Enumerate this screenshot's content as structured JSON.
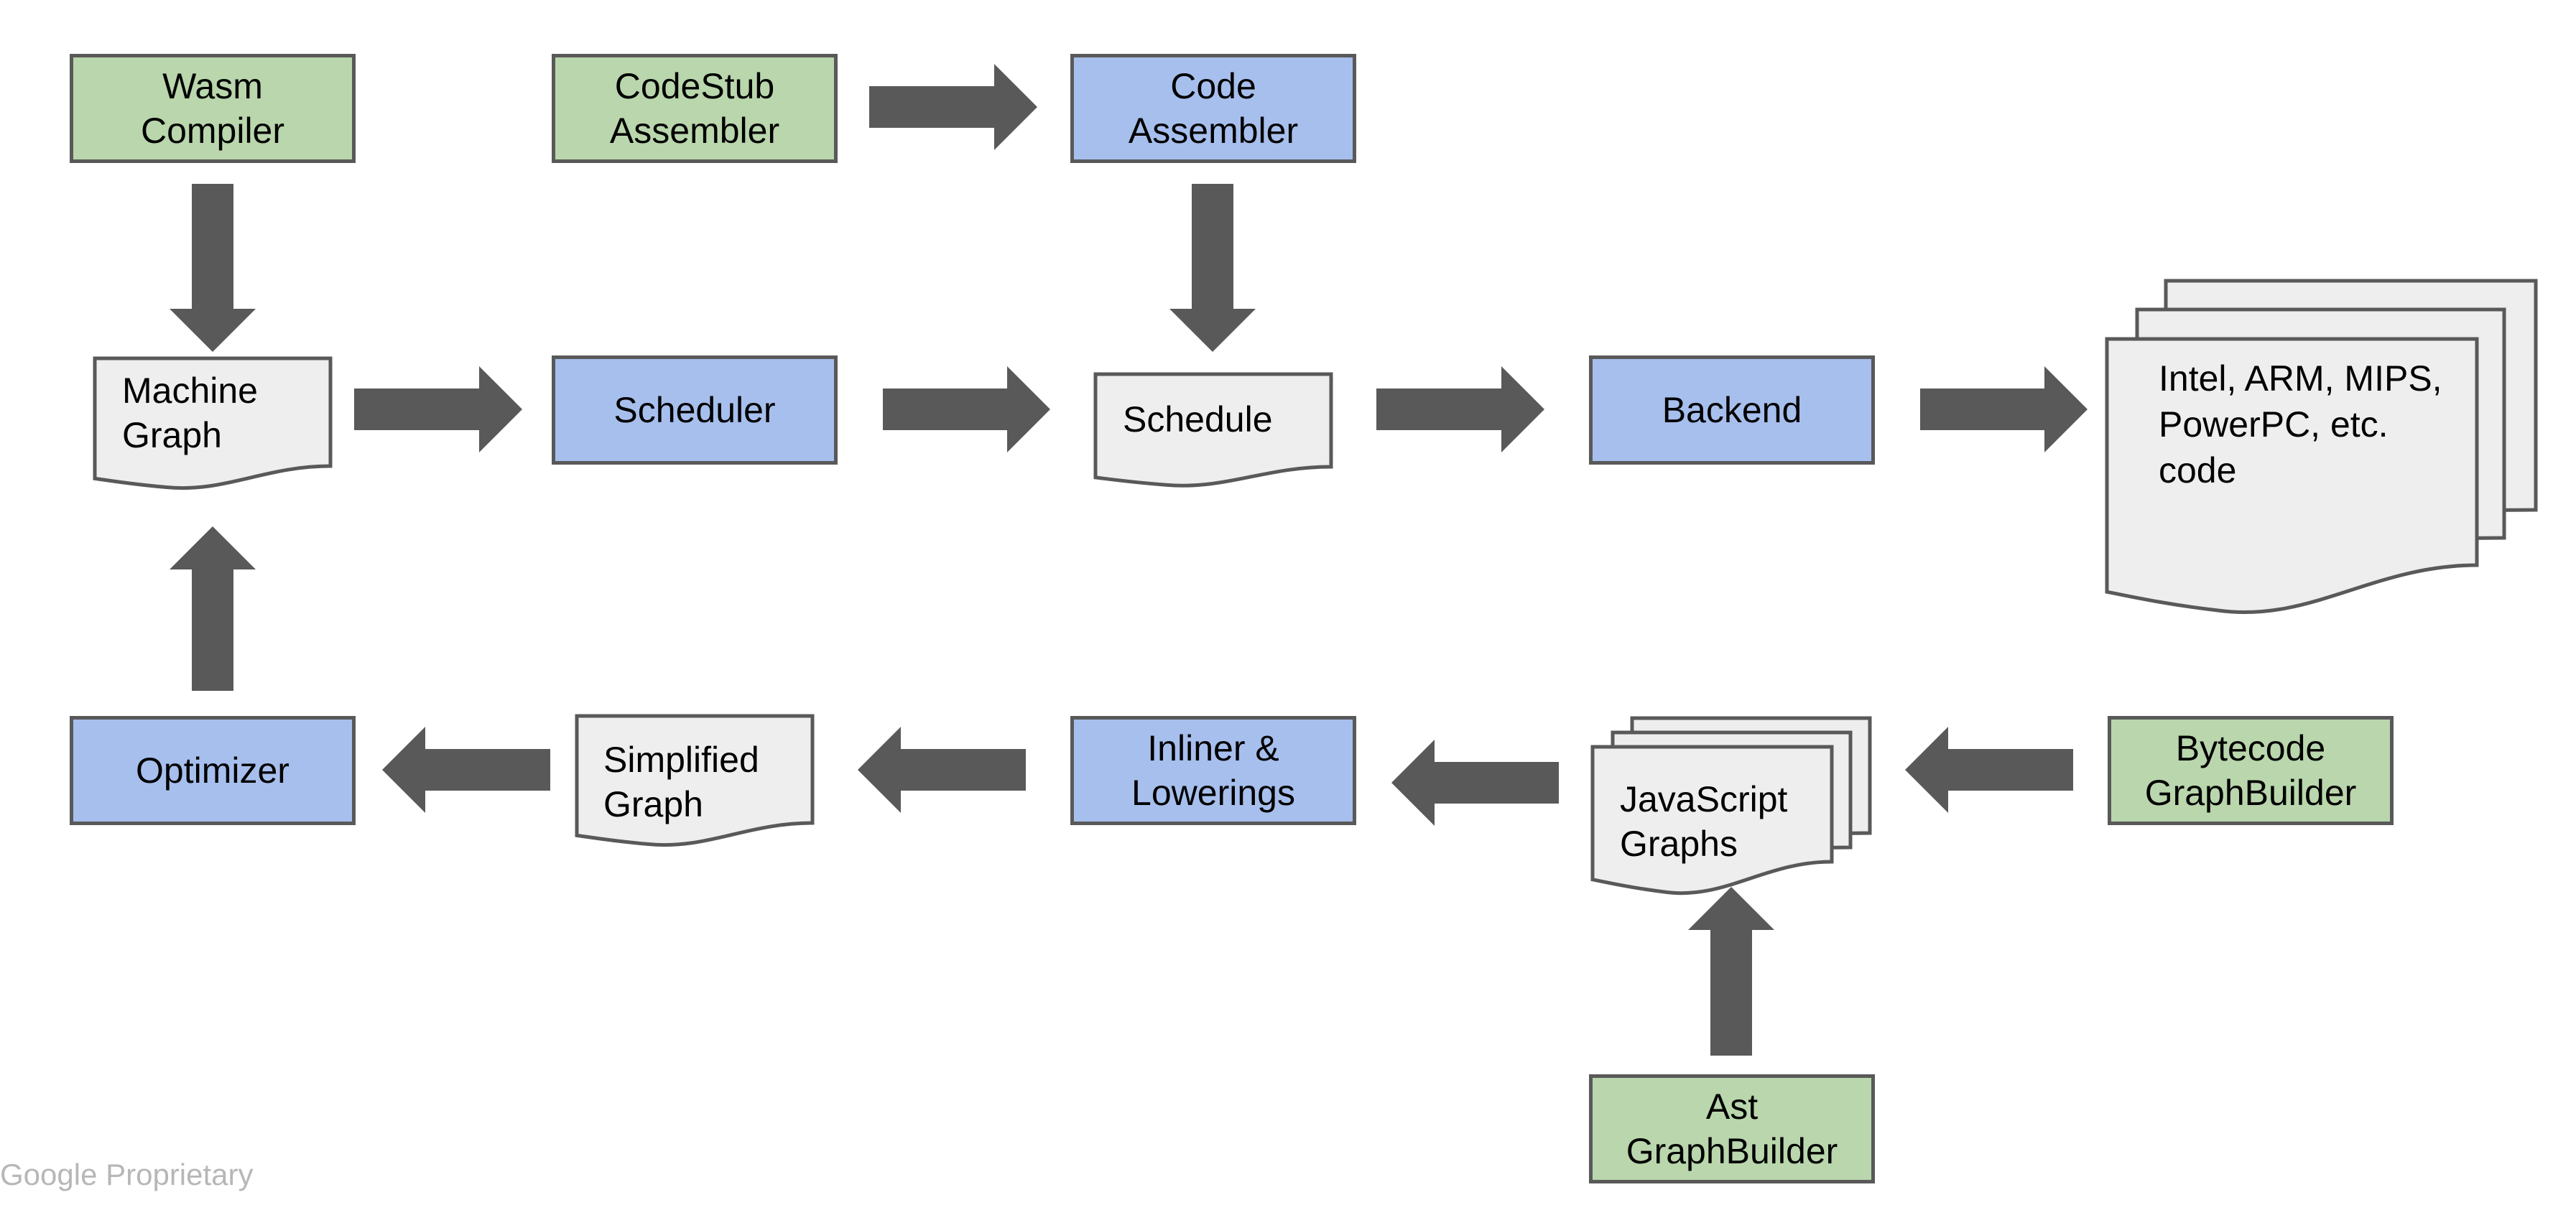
{
  "diagram": {
    "title": "",
    "colors": {
      "source_node": "#b9d6ac",
      "process_node": "#a7bfed",
      "document_node": "#eeeeee",
      "border": "#595959",
      "arrow": "#595959"
    },
    "nodes": {
      "wasm_compiler": {
        "type": "source",
        "lines": [
          "Wasm",
          "Compiler"
        ]
      },
      "codestub_assembler": {
        "type": "source",
        "lines": [
          "CodeStub",
          "Assembler"
        ]
      },
      "code_assembler": {
        "type": "process",
        "lines": [
          "Code",
          "Assembler"
        ]
      },
      "machine_graph": {
        "type": "document",
        "lines": [
          "Machine",
          "Graph"
        ]
      },
      "scheduler": {
        "type": "process",
        "lines": [
          "Scheduler"
        ]
      },
      "schedule": {
        "type": "document",
        "lines": [
          "Schedule"
        ]
      },
      "backend": {
        "type": "process",
        "lines": [
          "Backend"
        ]
      },
      "machine_code": {
        "type": "multi-document",
        "lines": [
          "Intel, ARM, MIPS,",
          "PowerPC, etc.",
          "code"
        ]
      },
      "optimizer": {
        "type": "process",
        "lines": [
          "Optimizer"
        ]
      },
      "simplified_graph": {
        "type": "document",
        "lines": [
          "Simplified",
          "Graph"
        ]
      },
      "inliner_lowerings": {
        "type": "process",
        "lines": [
          "Inliner &",
          "Lowerings"
        ]
      },
      "javascript_graphs": {
        "type": "multi-document",
        "lines": [
          "JavaScript",
          "Graphs"
        ]
      },
      "bytecode_graphbuilder": {
        "type": "source",
        "lines": [
          "Bytecode",
          "GraphBuilder"
        ]
      },
      "ast_graphbuilder": {
        "type": "source",
        "lines": [
          "Ast",
          "GraphBuilder"
        ]
      }
    },
    "edges": [
      {
        "from": "codestub_assembler",
        "to": "code_assembler"
      },
      {
        "from": "wasm_compiler",
        "to": "machine_graph"
      },
      {
        "from": "code_assembler",
        "to": "schedule"
      },
      {
        "from": "machine_graph",
        "to": "scheduler"
      },
      {
        "from": "scheduler",
        "to": "schedule"
      },
      {
        "from": "schedule",
        "to": "backend"
      },
      {
        "from": "backend",
        "to": "machine_code"
      },
      {
        "from": "optimizer",
        "to": "machine_graph"
      },
      {
        "from": "simplified_graph",
        "to": "optimizer"
      },
      {
        "from": "inliner_lowerings",
        "to": "simplified_graph"
      },
      {
        "from": "javascript_graphs",
        "to": "inliner_lowerings"
      },
      {
        "from": "bytecode_graphbuilder",
        "to": "javascript_graphs"
      },
      {
        "from": "ast_graphbuilder",
        "to": "javascript_graphs"
      }
    ]
  },
  "footer": {
    "text": "Google Proprietary"
  }
}
